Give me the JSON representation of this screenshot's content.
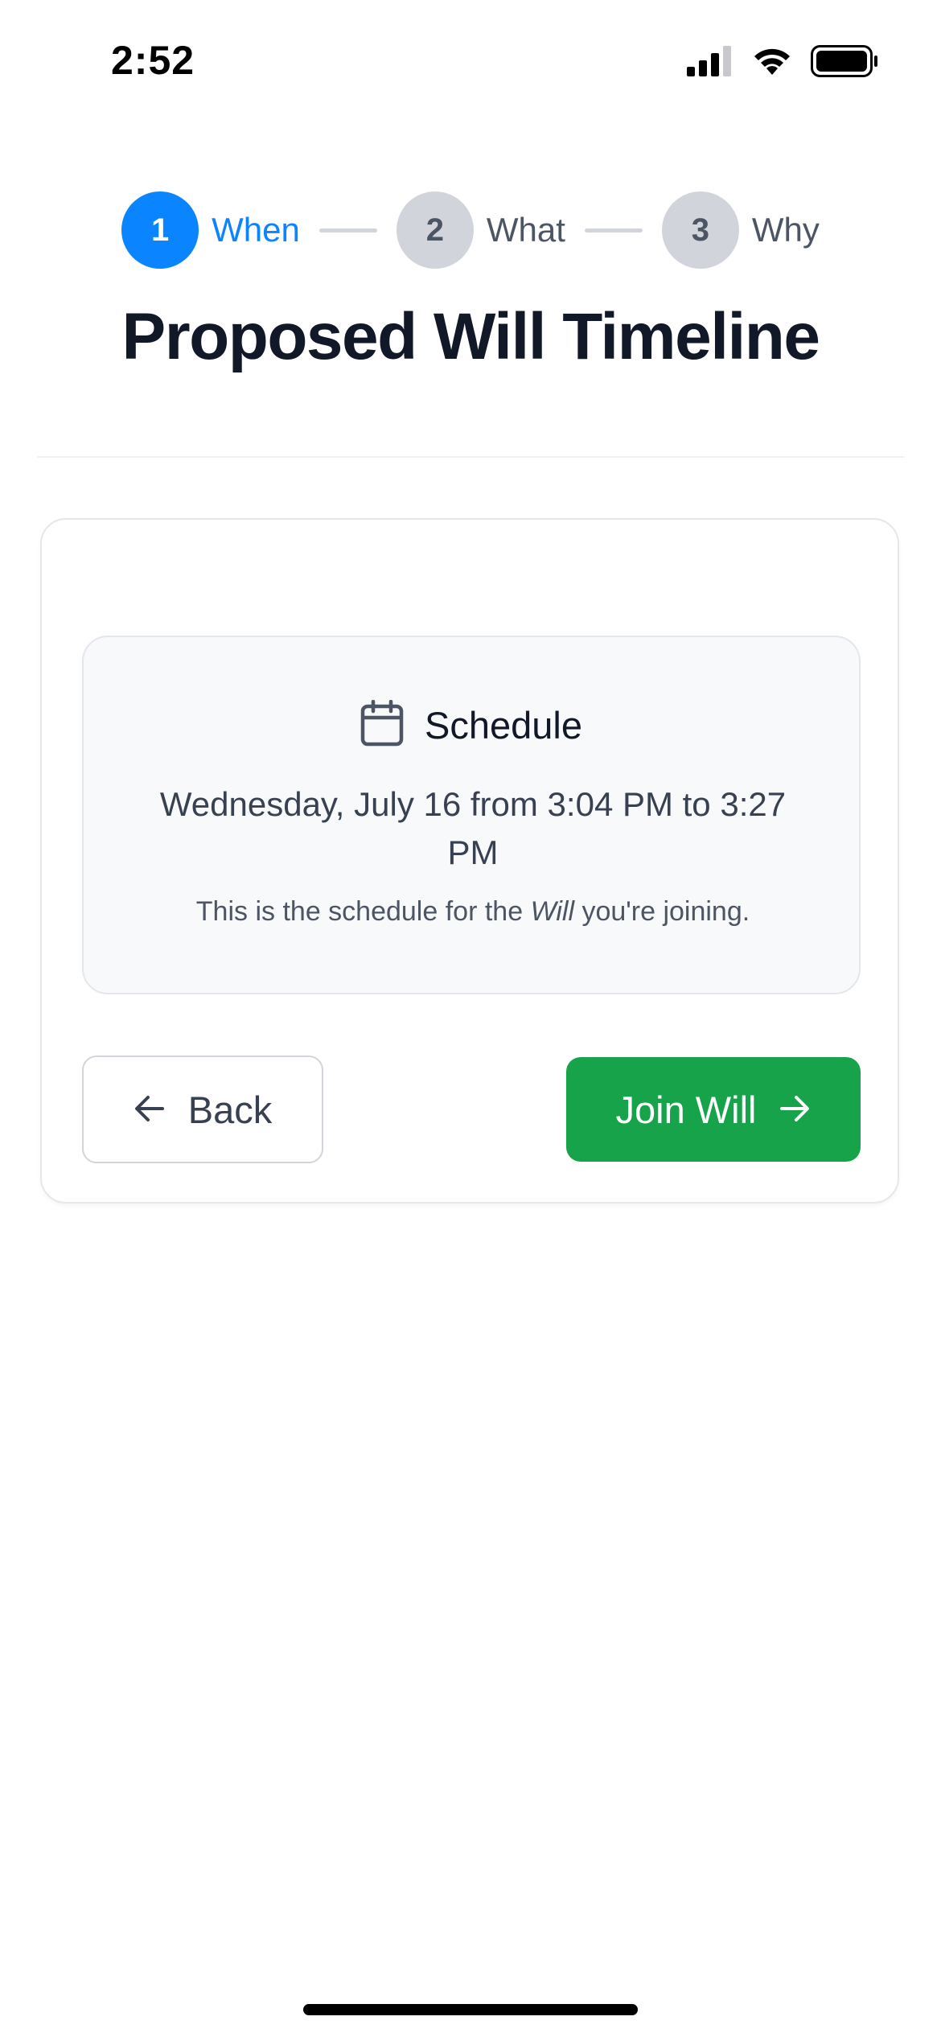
{
  "status_bar": {
    "time": "2:52",
    "icons": [
      "signal-icon",
      "wifi-icon",
      "battery-icon"
    ]
  },
  "stepper": {
    "steps": [
      {
        "number": "1",
        "label": "When",
        "active": true
      },
      {
        "number": "2",
        "label": "What",
        "active": false
      },
      {
        "number": "3",
        "label": "Why",
        "active": false
      }
    ]
  },
  "page_title": "Proposed Will Timeline",
  "schedule": {
    "icon": "calendar-icon",
    "title": "Schedule",
    "date_text": "Wednesday, July 16 from 3:04 PM to 3:27 PM",
    "note_before": "This is the schedule for the ",
    "note_emphasis": "Will",
    "note_after": " you're joining."
  },
  "actions": {
    "back_label": "Back",
    "join_label": "Join Will"
  },
  "colors": {
    "accent_blue": "#0a84ff",
    "join_green": "#16a34a",
    "inactive_step": "#d1d5db"
  }
}
